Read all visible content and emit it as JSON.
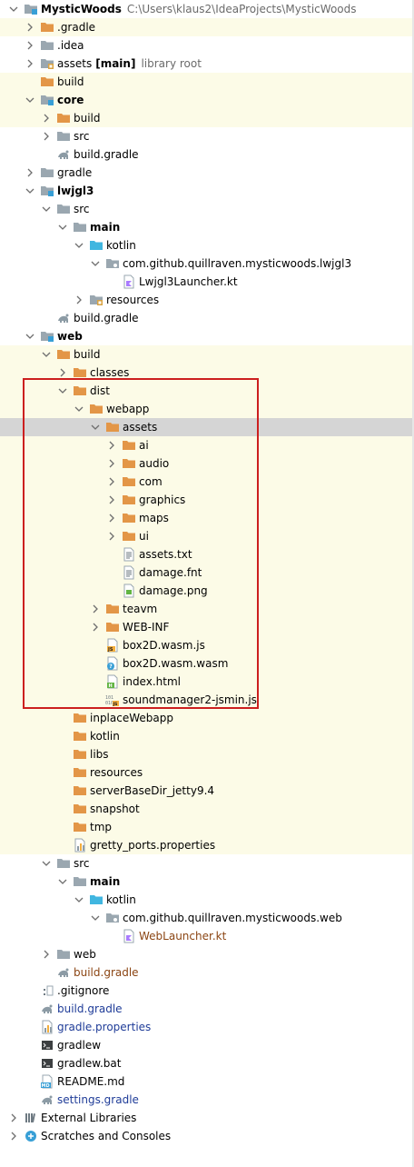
{
  "project_tree": {
    "rows": [
      {
        "label": "MysticWoods",
        "extra": "C:\\Users\\klaus2\\IdeaProjects\\MysticWoods",
        "depth": 0,
        "expanded": true,
        "icon": "folder-module-icon",
        "bold": true,
        "bg": "none"
      },
      {
        "label": ".gradle",
        "depth": 1,
        "expanded": false,
        "icon": "folder-excluded-icon",
        "bg": "excluded"
      },
      {
        "label": ".idea",
        "depth": 1,
        "expanded": false,
        "icon": "folder-icon",
        "bg": "none"
      },
      {
        "label": "assets",
        "tag": "[main]",
        "extra": "library root",
        "depth": 1,
        "expanded": false,
        "icon": "folder-resources-icon",
        "bg": "none"
      },
      {
        "label": "build",
        "depth": 1,
        "expanded": false,
        "icon": "folder-excluded-icon",
        "bg": "excluded",
        "noarrow": true
      },
      {
        "label": "core",
        "depth": 1,
        "expanded": true,
        "icon": "folder-module-icon",
        "bold": true,
        "bg": "excluded"
      },
      {
        "label": "build",
        "depth": 2,
        "expanded": false,
        "icon": "folder-excluded-icon",
        "bg": "excluded"
      },
      {
        "label": "src",
        "depth": 2,
        "expanded": false,
        "icon": "folder-icon",
        "bg": "none"
      },
      {
        "label": "build.gradle",
        "depth": 2,
        "icon": "gradle-file-icon",
        "bg": "none",
        "noarrow": true
      },
      {
        "label": "gradle",
        "depth": 1,
        "expanded": false,
        "icon": "folder-icon",
        "bg": "none"
      },
      {
        "label": "lwjgl3",
        "depth": 1,
        "expanded": true,
        "icon": "folder-module-icon",
        "bold": true,
        "bg": "none"
      },
      {
        "label": "src",
        "depth": 2,
        "expanded": true,
        "icon": "folder-icon",
        "bg": "none"
      },
      {
        "label": "main",
        "depth": 3,
        "expanded": true,
        "icon": "folder-icon",
        "bold": true,
        "bg": "none"
      },
      {
        "label": "kotlin",
        "depth": 4,
        "expanded": true,
        "icon": "folder-source-icon",
        "bg": "none"
      },
      {
        "label": "com.github.quillraven.mysticwoods.lwjgl3",
        "depth": 5,
        "expanded": true,
        "icon": "package-icon",
        "bg": "none"
      },
      {
        "label": "Lwjgl3Launcher.kt",
        "depth": 6,
        "icon": "kotlin-file-icon",
        "bg": "none",
        "noarrow": true
      },
      {
        "label": "resources",
        "depth": 4,
        "expanded": false,
        "icon": "folder-resources-icon",
        "bg": "none"
      },
      {
        "label": "build.gradle",
        "depth": 2,
        "icon": "gradle-file-icon",
        "bg": "none",
        "noarrow": true
      },
      {
        "label": "web",
        "depth": 1,
        "expanded": true,
        "icon": "folder-module-icon",
        "bold": true,
        "bg": "none"
      },
      {
        "label": "build",
        "depth": 2,
        "expanded": true,
        "icon": "folder-excluded-icon",
        "bg": "excluded"
      },
      {
        "label": "classes",
        "depth": 3,
        "expanded": false,
        "icon": "folder-excluded-icon",
        "bg": "excluded"
      },
      {
        "label": "dist",
        "depth": 3,
        "expanded": true,
        "icon": "folder-excluded-icon",
        "bg": "excluded"
      },
      {
        "label": "webapp",
        "depth": 4,
        "expanded": true,
        "icon": "folder-excluded-icon",
        "bg": "excluded"
      },
      {
        "label": "assets",
        "depth": 5,
        "expanded": true,
        "icon": "folder-excluded-icon",
        "bg": "selected"
      },
      {
        "label": "ai",
        "depth": 6,
        "expanded": false,
        "icon": "folder-excluded-icon",
        "bg": "excluded"
      },
      {
        "label": "audio",
        "depth": 6,
        "expanded": false,
        "icon": "folder-excluded-icon",
        "bg": "excluded"
      },
      {
        "label": "com",
        "depth": 6,
        "expanded": false,
        "icon": "folder-excluded-icon",
        "bg": "excluded"
      },
      {
        "label": "graphics",
        "depth": 6,
        "expanded": false,
        "icon": "folder-excluded-icon",
        "bg": "excluded"
      },
      {
        "label": "maps",
        "depth": 6,
        "expanded": false,
        "icon": "folder-excluded-icon",
        "bg": "excluded"
      },
      {
        "label": "ui",
        "depth": 6,
        "expanded": false,
        "icon": "folder-excluded-icon",
        "bg": "excluded"
      },
      {
        "label": "assets.txt",
        "depth": 6,
        "icon": "text-file-icon",
        "bg": "excluded",
        "noarrow": true
      },
      {
        "label": "damage.fnt",
        "depth": 6,
        "icon": "text-file-icon",
        "bg": "excluded",
        "noarrow": true
      },
      {
        "label": "damage.png",
        "depth": 6,
        "icon": "image-file-icon",
        "bg": "excluded",
        "noarrow": true
      },
      {
        "label": "teavm",
        "depth": 5,
        "expanded": false,
        "icon": "folder-excluded-icon",
        "bg": "excluded"
      },
      {
        "label": "WEB-INF",
        "depth": 5,
        "expanded": false,
        "icon": "folder-excluded-icon",
        "bg": "excluded"
      },
      {
        "label": "box2D.wasm.js",
        "depth": 5,
        "icon": "js-file-icon",
        "bg": "excluded",
        "noarrow": true
      },
      {
        "label": "box2D.wasm.wasm",
        "depth": 5,
        "icon": "unknown-file-icon",
        "bg": "excluded",
        "noarrow": true
      },
      {
        "label": "index.html",
        "depth": 5,
        "icon": "html-file-icon",
        "bg": "excluded",
        "noarrow": true
      },
      {
        "label": "soundmanager2-jsmin.js",
        "depth": 5,
        "icon": "binary-file-icon",
        "bg": "excluded",
        "noarrow": true
      },
      {
        "label": "inplaceWebapp",
        "depth": 3,
        "expanded": false,
        "icon": "folder-excluded-icon",
        "bg": "excluded",
        "noarrow": true
      },
      {
        "label": "kotlin",
        "depth": 3,
        "expanded": false,
        "icon": "folder-excluded-icon",
        "bg": "excluded",
        "noarrow": true
      },
      {
        "label": "libs",
        "depth": 3,
        "expanded": false,
        "icon": "folder-excluded-icon",
        "bg": "excluded",
        "noarrow": true
      },
      {
        "label": "resources",
        "depth": 3,
        "expanded": false,
        "icon": "folder-excluded-icon",
        "bg": "excluded",
        "noarrow": true
      },
      {
        "label": "serverBaseDir_jetty9.4",
        "depth": 3,
        "expanded": false,
        "icon": "folder-excluded-icon",
        "bg": "excluded",
        "noarrow": true
      },
      {
        "label": "snapshot",
        "depth": 3,
        "expanded": false,
        "icon": "folder-excluded-icon",
        "bg": "excluded",
        "noarrow": true
      },
      {
        "label": "tmp",
        "depth": 3,
        "expanded": false,
        "icon": "folder-excluded-icon",
        "bg": "excluded",
        "noarrow": true
      },
      {
        "label": "gretty_ports.properties",
        "depth": 3,
        "icon": "properties-file-icon",
        "bg": "excluded",
        "noarrow": true
      },
      {
        "label": "src",
        "depth": 2,
        "expanded": true,
        "icon": "folder-icon",
        "bg": "none"
      },
      {
        "label": "main",
        "depth": 3,
        "expanded": true,
        "icon": "folder-icon",
        "bold": true,
        "bg": "none"
      },
      {
        "label": "kotlin",
        "depth": 4,
        "expanded": true,
        "icon": "folder-source-icon",
        "bg": "none"
      },
      {
        "label": "com.github.quillraven.mysticwoods.web",
        "depth": 5,
        "expanded": true,
        "icon": "package-icon",
        "bg": "none"
      },
      {
        "label": "WebLauncher.kt",
        "depth": 6,
        "icon": "kotlin-file-icon",
        "bg": "none",
        "noarrow": true,
        "color": "brown"
      },
      {
        "label": "web",
        "depth": 2,
        "expanded": false,
        "icon": "folder-icon",
        "bg": "none"
      },
      {
        "label": "build.gradle",
        "depth": 2,
        "icon": "gradle-file-icon",
        "bg": "none",
        "noarrow": true,
        "color": "brown"
      },
      {
        "label": ".gitignore",
        "depth": 1,
        "icon": "ignore-file-icon",
        "bg": "none",
        "noarrow": true
      },
      {
        "label": "build.gradle",
        "depth": 1,
        "icon": "gradle-file-icon",
        "bg": "none",
        "noarrow": true,
        "color": "blue"
      },
      {
        "label": "gradle.properties",
        "depth": 1,
        "icon": "properties-file-icon",
        "bg": "none",
        "noarrow": true,
        "color": "blue"
      },
      {
        "label": "gradlew",
        "depth": 1,
        "icon": "terminal-file-icon",
        "bg": "none",
        "noarrow": true
      },
      {
        "label": "gradlew.bat",
        "depth": 1,
        "icon": "terminal-file-icon",
        "bg": "none",
        "noarrow": true
      },
      {
        "label": "README.md",
        "depth": 1,
        "icon": "markdown-file-icon",
        "bg": "none",
        "noarrow": true
      },
      {
        "label": "settings.gradle",
        "depth": 1,
        "icon": "gradle-file-icon",
        "bg": "none",
        "noarrow": true,
        "color": "blue"
      },
      {
        "label": "External Libraries",
        "depth": 0,
        "expanded": false,
        "icon": "libraries-icon",
        "bg": "none"
      },
      {
        "label": "Scratches and Consoles",
        "depth": 0,
        "expanded": false,
        "icon": "scratches-icon",
        "bg": "none"
      }
    ]
  },
  "colors": {
    "folder": "#e8a94a",
    "folder_excluded": "#e39647",
    "folder_plain": "#9aa7b0",
    "folder_source": "#40b6e0",
    "module_square": "#389fd6",
    "highlight_box": "#cc1f1f",
    "excluded_bg": "#fcfbe7",
    "selected_bg": "#d5d5d5"
  }
}
